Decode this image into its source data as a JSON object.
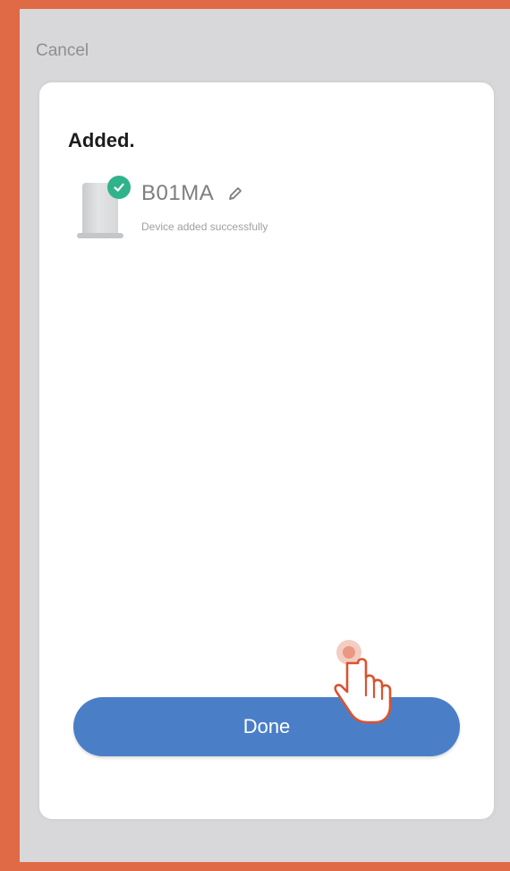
{
  "header": {
    "cancel_label": "Cancel"
  },
  "sheet": {
    "title": "Added.",
    "device": {
      "name": "B01MA",
      "status": "Device added successfully",
      "status_icon": "check-icon",
      "edit_icon": "pencil-icon"
    },
    "done_label": "Done"
  },
  "overlay": {
    "pointer_icon": "hand-pointer-icon"
  },
  "colors": {
    "frame_border": "#e06a45",
    "screen_background": "#d8d8da",
    "button": "#4a7fc8",
    "check_badge": "#2fb38a"
  }
}
